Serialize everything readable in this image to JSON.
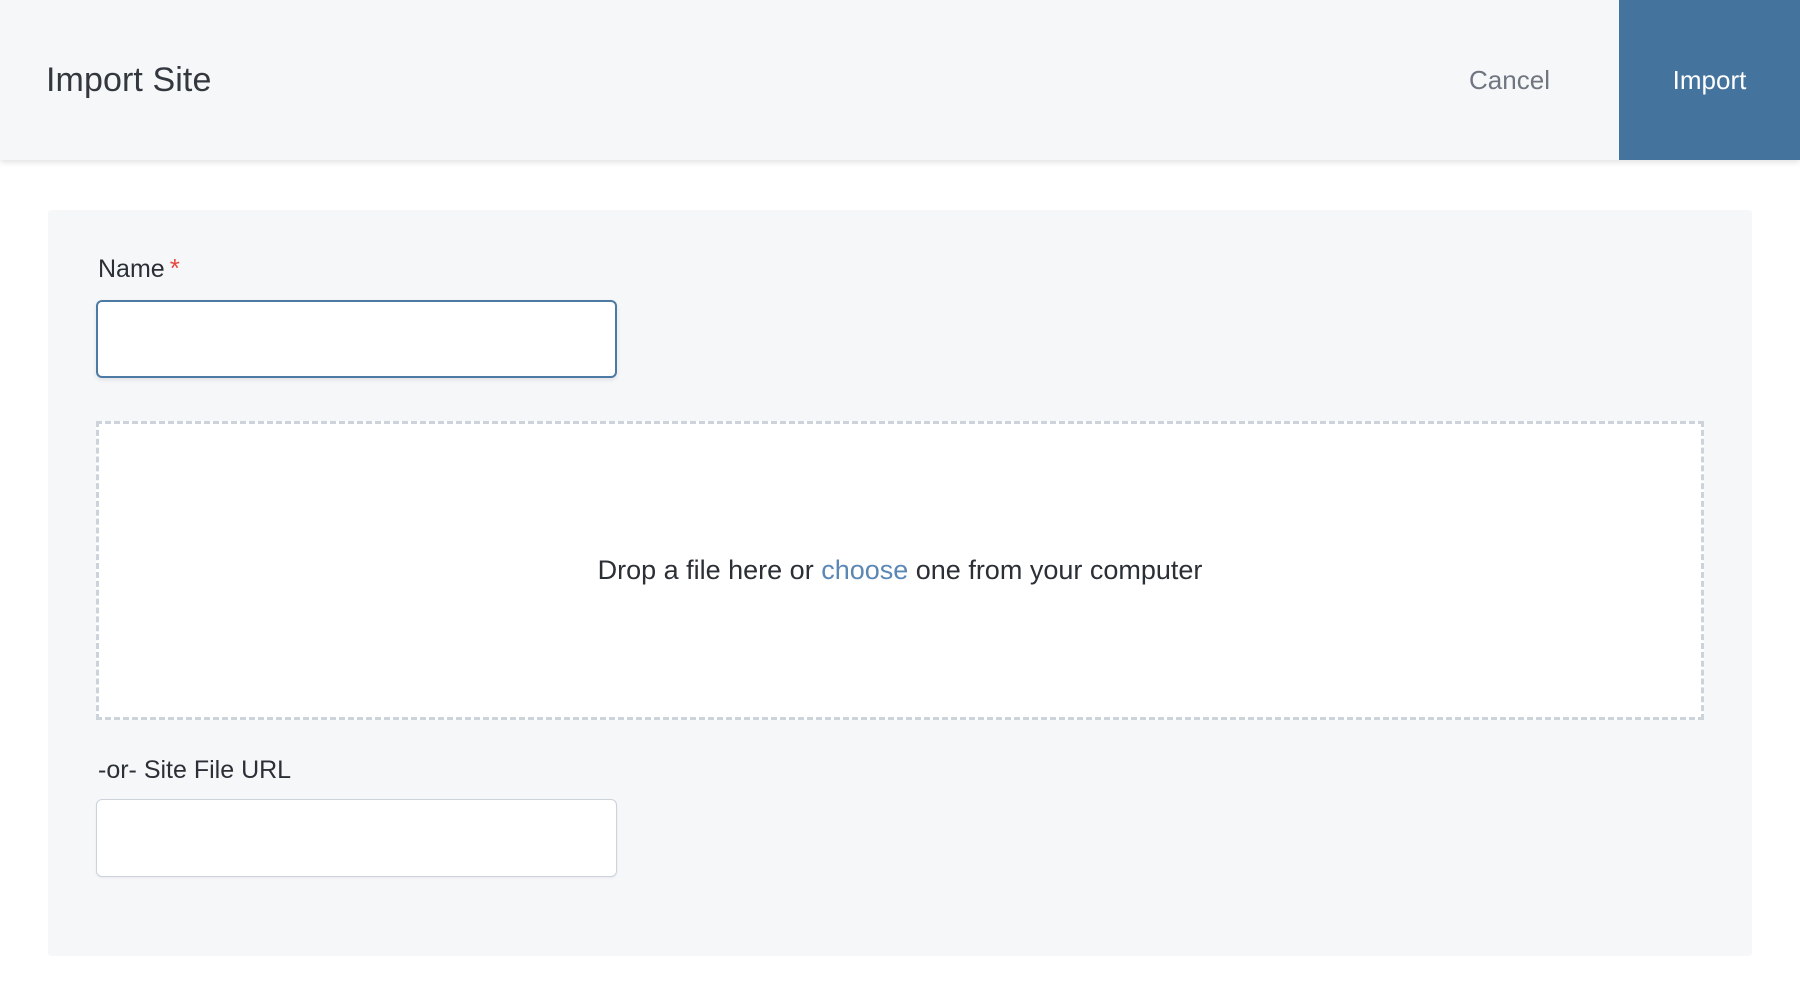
{
  "header": {
    "title": "Import Site",
    "cancel_label": "Cancel",
    "import_label": "Import",
    "import_button_color": "#44739e",
    "background_color": "#f6f7f9"
  },
  "form": {
    "name_field": {
      "label": "Name",
      "required_marker": "*",
      "value": "",
      "placeholder": ""
    },
    "dropzone": {
      "text_before_link": "Drop a file here or ",
      "link_label": "choose",
      "text_after_link": " one from your computer",
      "link_color": "#5b87b5"
    },
    "url_field": {
      "label": "-or- Site File URL",
      "value": "",
      "placeholder": ""
    }
  },
  "theme": {
    "page_background": "#ffffff",
    "panel_background": "#f6f7f9",
    "required_color": "#e8483f",
    "input_focus_border": "#4c7aa3",
    "input_border": "#ccd3db"
  }
}
